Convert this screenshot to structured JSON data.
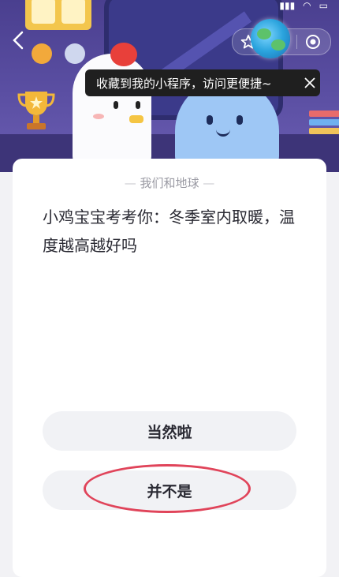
{
  "topbar": {
    "back_icon": "chevron-left-icon",
    "capsule_icons": [
      "star-icon",
      "more-dots-icon",
      "target-circle-icon"
    ]
  },
  "tooltip": {
    "text": "收藏到我的小程序，访问更便捷~",
    "close_icon": "close-icon"
  },
  "card": {
    "header": "我们和地球",
    "question": "小鸡宝宝考考你：冬季室内取暖，温度越高越好吗",
    "options": [
      {
        "label": "当然啦"
      },
      {
        "label": "并不是"
      }
    ]
  },
  "colors": {
    "hero_bg": "#5b4fa3",
    "card_bg": "#ffffff",
    "option_bg": "#f1f2f5",
    "highlight_ring": "#e0445a"
  }
}
